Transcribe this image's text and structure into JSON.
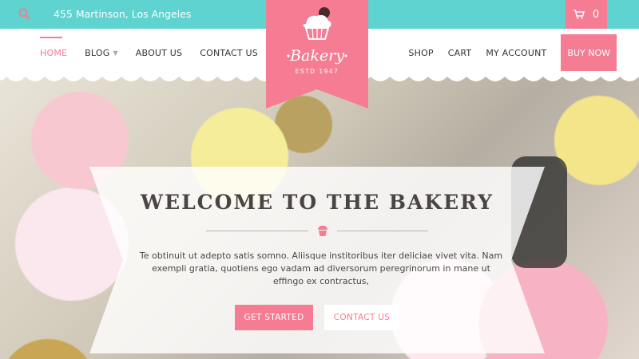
{
  "topbar": {
    "address": "455 Martinson, Los Angeles",
    "cart_count": "0",
    "search_icon": "search-icon",
    "cart_icon": "cart-icon"
  },
  "nav": {
    "left": [
      {
        "label": "HOME",
        "active": true
      },
      {
        "label": "BLOG",
        "has_dropdown": true
      },
      {
        "label": "ABOUT US"
      },
      {
        "label": "CONTACT US"
      }
    ],
    "right": [
      {
        "label": "SHOP"
      },
      {
        "label": "CART"
      },
      {
        "label": "MY ACCOUNT"
      }
    ],
    "buy_now": "BUY NOW"
  },
  "logo": {
    "name": "Bakery",
    "estd": "ESTD 1947",
    "icon": "cupcake-icon"
  },
  "hero": {
    "title": "WELCOME TO THE BAKERY",
    "text": "Te obtinuit ut adepto satis somno. Aliisque institoribus iter deliciae vivet vita. Nam exempli gratia, quotiens ego vadam ad diversorum peregrinorum in mane ut effingo ex contractus,",
    "primary_button": "GET STARTED",
    "secondary_button": "CONTACT US"
  },
  "colors": {
    "teal": "#5ed3cf",
    "pink": "#f57c93"
  }
}
